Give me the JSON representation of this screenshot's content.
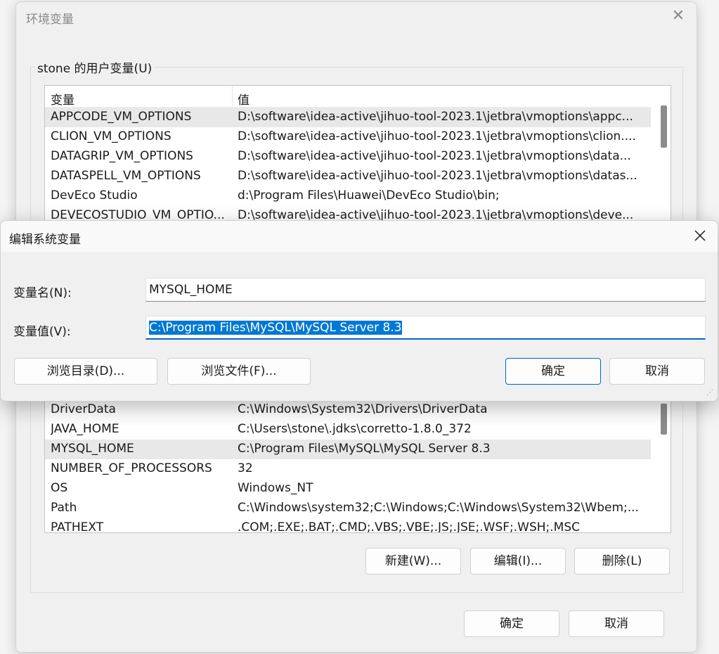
{
  "env_window": {
    "title": "环境变量",
    "group_title": "stone 的用户变量(U)",
    "columns": [
      "变量",
      "值"
    ],
    "rows": [
      {
        "name": "APPCODE_VM_OPTIONS",
        "value": "D:\\software\\idea-active\\jihuo-tool-2023.1\\jetbra\\vmoptions\\appc..."
      },
      {
        "name": "CLION_VM_OPTIONS",
        "value": "D:\\software\\idea-active\\jihuo-tool-2023.1\\jetbra\\vmoptions\\clion...."
      },
      {
        "name": "DATAGRIP_VM_OPTIONS",
        "value": "D:\\software\\idea-active\\jihuo-tool-2023.1\\jetbra\\vmoptions\\data..."
      },
      {
        "name": "DATASPELL_VM_OPTIONS",
        "value": "D:\\software\\idea-active\\jihuo-tool-2023.1\\jetbra\\vmoptions\\datas..."
      },
      {
        "name": "DevEco Studio",
        "value": "d:\\Program Files\\Huawei\\DevEco Studio\\bin;"
      },
      {
        "name": "DEVECOSTUDIO_VM_OPTIO...",
        "value": "D:\\software\\idea-active\\jihuo-tool-2023.1\\jetbra\\vmoptions\\deve..."
      }
    ],
    "system_rows": [
      {
        "name": "DriverData",
        "value": "C:\\Windows\\System32\\Drivers\\DriverData"
      },
      {
        "name": "JAVA_HOME",
        "value": "C:\\Users\\stone\\.jdks\\corretto-1.8.0_372"
      },
      {
        "name": "MYSQL_HOME",
        "value": "C:\\Program Files\\MySQL\\MySQL Server 8.3"
      },
      {
        "name": "NUMBER_OF_PROCESSORS",
        "value": "32"
      },
      {
        "name": "OS",
        "value": "Windows_NT"
      },
      {
        "name": "Path",
        "value": "C:\\Windows\\system32;C:\\Windows;C:\\Windows\\System32\\Wbem;..."
      },
      {
        "name": "PATHEXT",
        "value": ".COM;.EXE;.BAT;.CMD;.VBS;.VBE;.JS;.JSE;.WSF;.WSH;.MSC"
      }
    ],
    "buttons": {
      "new": "新建(W)...",
      "edit": "编辑(I)...",
      "delete": "删除(L)"
    },
    "ok": "确定",
    "cancel": "取消"
  },
  "edit_dialog": {
    "title": "编辑系统变量",
    "name_label": "变量名(N):",
    "name_value": "MYSQL_HOME",
    "value_label": "变量值(V):",
    "value_value": "C:\\Program Files\\MySQL\\MySQL Server 8.3",
    "browse_dir": "浏览目录(D)...",
    "browse_file": "浏览文件(F)...",
    "ok": "确定",
    "cancel": "取消"
  },
  "colors": {
    "accent": "#0067c0",
    "selection": "#0078d4"
  }
}
